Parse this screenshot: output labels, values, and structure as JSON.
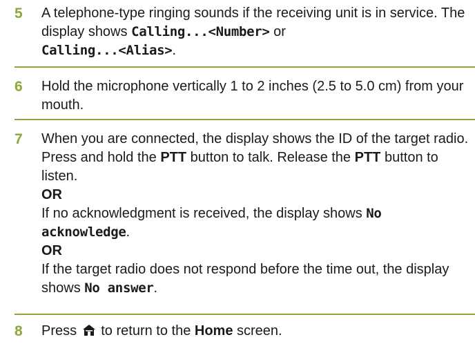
{
  "steps": [
    {
      "number": "5",
      "text1": "A telephone-type ringing sounds if the receiving unit is in service. The display shows ",
      "code1": "Calling...<Number>",
      "text2": " or ",
      "code2": "Calling...<Alias>",
      "text3": "."
    },
    {
      "number": "6",
      "text": "Hold the microphone vertically 1 to 2 inches (2.5 to 5.0 cm) from your mouth."
    },
    {
      "number": "7",
      "p1_a": "When you are connected, the display shows the ID of the target radio. Press and hold the ",
      "p1_b1": "PTT",
      "p1_c": " button to talk. Release the ",
      "p1_b2": "PTT",
      "p1_d": " button to listen.",
      "or1": "OR",
      "p2_a": "If no acknowledgment is received, the display shows ",
      "p2_code": "No acknowledge",
      "p2_b": ".",
      "or2": "OR",
      "p3_a": "If the target radio does not respond before the time out, the display shows ",
      "p3_code": "No answer",
      "p3_b": "."
    },
    {
      "number": "8",
      "t1": "Press ",
      "icon": "home-icon",
      "t2": " to return to the ",
      "bold": "Home",
      "t3": " screen."
    }
  ],
  "colors": {
    "accent": "#8aa83c",
    "text": "#1a1a1a"
  }
}
